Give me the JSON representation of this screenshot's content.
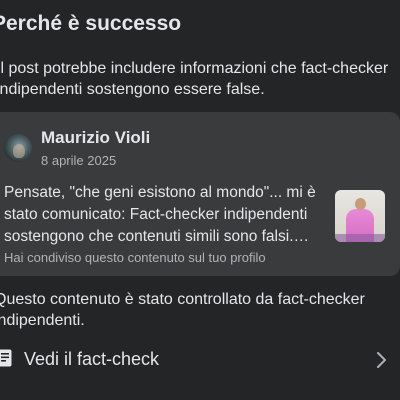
{
  "section": {
    "title": "Perché è successo"
  },
  "intro": {
    "text": "Il post potrebbe includere informazioni che fact-checker indipendenti sostengono essere false."
  },
  "post": {
    "author": "Maurizio Violi",
    "date": "8 aprile 2025",
    "text": "Pensate, \"che geni esistono al mondo\"... mi è stato comunicato: Fact-checker indipendenti sostengono che contenuti simili sono falsi.…",
    "shared_note": "Hai condiviso questo contenuto sul tuo profilo"
  },
  "checked": {
    "text": "Questo contenuto è stato controllato da fact-checker indipendenti."
  },
  "factcheck": {
    "label": "Vedi il fact-check",
    "icon": "document-icon",
    "chevron_icon": "chevron-right-icon"
  },
  "colors": {
    "background": "#242526",
    "card": "#3a3b3c",
    "text_primary": "#e4e6eb",
    "text_secondary": "#b0b3b8"
  }
}
